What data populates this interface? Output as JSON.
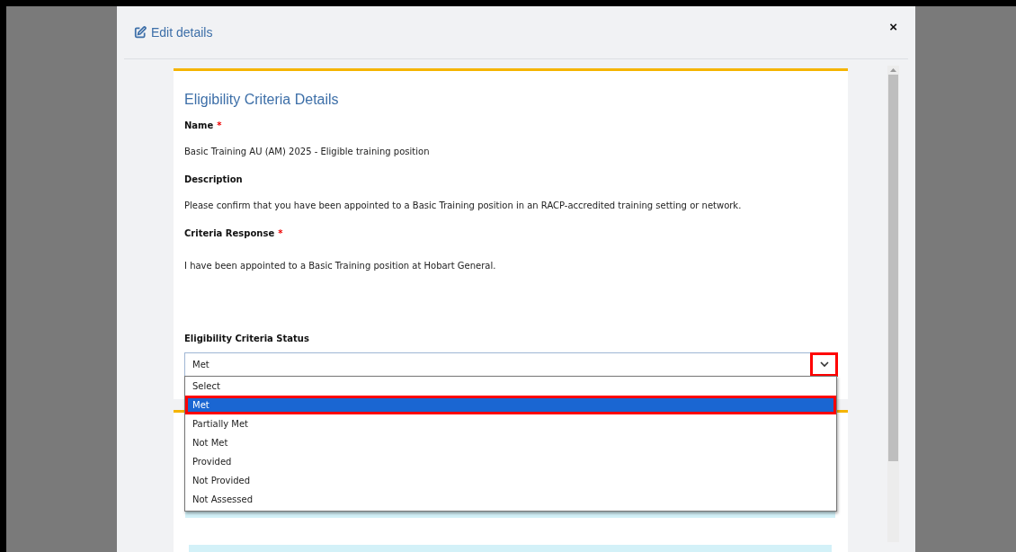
{
  "dialog": {
    "title": "Edit details",
    "close": "×"
  },
  "card": {
    "title": "Eligibility Criteria Details",
    "fields": [
      {
        "label": "Name",
        "required_mark": "*",
        "value": "Basic Training AU (AM) 2025 - Eligible training position"
      },
      {
        "label": "Description",
        "value": "Please confirm that you have been appointed to a Basic Training position in an RACP-accredited training setting or network."
      },
      {
        "label": "Criteria Response",
        "required_mark": "*",
        "value": "I have been appointed to a Basic Training position at Hobart General."
      }
    ],
    "status": {
      "label": "Eligibility Criteria Status",
      "value": "Met",
      "chevron_highlighted": true,
      "options": [
        {
          "label": "Select",
          "selected": false,
          "highlighted": false
        },
        {
          "label": "Met",
          "selected": true,
          "highlighted": true
        },
        {
          "label": "Partially Met",
          "selected": false,
          "highlighted": false
        },
        {
          "label": "Not Met",
          "selected": false,
          "highlighted": false
        },
        {
          "label": "Provided",
          "selected": false,
          "highlighted": false
        },
        {
          "label": "Not Provided",
          "selected": false,
          "highlighted": false
        },
        {
          "label": "Not Assessed",
          "selected": false,
          "highlighted": false
        }
      ]
    }
  }
}
